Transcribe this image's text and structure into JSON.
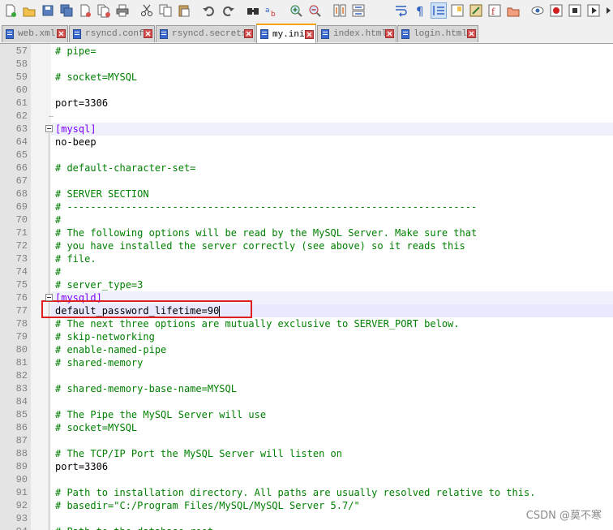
{
  "toolbar": {
    "icons": [
      {
        "name": "new-file-icon"
      },
      {
        "name": "open-file-icon"
      },
      {
        "name": "save-icon"
      },
      {
        "name": "save-all-icon"
      },
      {
        "name": "close-icon"
      },
      {
        "name": "close-all-icon"
      },
      {
        "name": "print-icon"
      },
      {
        "name": "cut-icon"
      },
      {
        "name": "copy-icon"
      },
      {
        "name": "paste-icon"
      },
      {
        "name": "undo-icon"
      },
      {
        "name": "redo-icon"
      },
      {
        "name": "find-icon"
      },
      {
        "name": "replace-icon"
      },
      {
        "name": "zoom-in-icon"
      },
      {
        "name": "zoom-out-icon"
      },
      {
        "name": "sync-vertical-icon"
      },
      {
        "name": "sync-horizontal-icon"
      },
      {
        "name": "word-wrap-icon"
      },
      {
        "name": "show-all-characters-icon"
      },
      {
        "name": "indent-guide-icon"
      },
      {
        "name": "document-map-icon"
      },
      {
        "name": "function-list-icon"
      },
      {
        "name": "folder-workspace-icon"
      },
      {
        "name": "monitoring-icon"
      },
      {
        "name": "record-macro-icon"
      },
      {
        "name": "stop-recording-icon"
      },
      {
        "name": "playback-macro-icon"
      },
      {
        "name": "run-macro-multiple-icon"
      }
    ]
  },
  "tabs": [
    {
      "label": "web.xml",
      "active": false
    },
    {
      "label": "rsyncd.conf",
      "active": false
    },
    {
      "label": "rsyncd.secrets",
      "active": false
    },
    {
      "label": "my.ini",
      "active": true
    },
    {
      "label": "index.html",
      "active": false
    },
    {
      "label": "login.html",
      "active": false
    }
  ],
  "editor": {
    "lines": [
      {
        "n": "57",
        "text": "# pipe=",
        "kind": "comment"
      },
      {
        "n": "58",
        "text": "",
        "kind": "blank"
      },
      {
        "n": "59",
        "text": "# socket=MYSQL",
        "kind": "comment"
      },
      {
        "n": "60",
        "text": "",
        "kind": "blank"
      },
      {
        "n": "61",
        "key": "port",
        "value": "3306",
        "kind": "kv"
      },
      {
        "n": "62",
        "text": "",
        "kind": "blank"
      },
      {
        "n": "63",
        "text": "[mysql]",
        "kind": "section"
      },
      {
        "n": "64",
        "text": "no-beep",
        "kind": "plain"
      },
      {
        "n": "65",
        "text": "",
        "kind": "blank"
      },
      {
        "n": "66",
        "text": "# default-character-set=",
        "kind": "comment"
      },
      {
        "n": "67",
        "text": "",
        "kind": "blank"
      },
      {
        "n": "68",
        "text": "# SERVER SECTION",
        "kind": "comment"
      },
      {
        "n": "69",
        "text": "# ----------------------------------------------------------------------",
        "kind": "comment"
      },
      {
        "n": "70",
        "text": "#",
        "kind": "comment"
      },
      {
        "n": "71",
        "text": "# The following options will be read by the MySQL Server. Make sure that",
        "kind": "comment"
      },
      {
        "n": "72",
        "text": "# you have installed the server correctly (see above) so it reads this",
        "kind": "comment"
      },
      {
        "n": "73",
        "text": "# file.",
        "kind": "comment"
      },
      {
        "n": "74",
        "text": "#",
        "kind": "comment"
      },
      {
        "n": "75",
        "text": "# server_type=3",
        "kind": "comment"
      },
      {
        "n": "76",
        "text": "[mysqld]",
        "kind": "section"
      },
      {
        "n": "77",
        "key": "default_password_lifetime",
        "value": "90",
        "kind": "kv"
      },
      {
        "n": "78",
        "text": "# The next three options are mutually exclusive to SERVER_PORT below.",
        "kind": "comment"
      },
      {
        "n": "79",
        "text": "# skip-networking",
        "kind": "comment"
      },
      {
        "n": "80",
        "text": "# enable-named-pipe",
        "kind": "comment"
      },
      {
        "n": "81",
        "text": "# shared-memory",
        "kind": "comment"
      },
      {
        "n": "82",
        "text": "",
        "kind": "blank"
      },
      {
        "n": "83",
        "text": "# shared-memory-base-name=MYSQL",
        "kind": "comment"
      },
      {
        "n": "84",
        "text": "",
        "kind": "blank"
      },
      {
        "n": "85",
        "text": "# The Pipe the MySQL Server will use",
        "kind": "comment"
      },
      {
        "n": "86",
        "text": "# socket=MYSQL",
        "kind": "comment"
      },
      {
        "n": "87",
        "text": "",
        "kind": "blank"
      },
      {
        "n": "88",
        "text": "# The TCP/IP Port the MySQL Server will listen on",
        "kind": "comment"
      },
      {
        "n": "89",
        "key": "port",
        "value": "3306",
        "kind": "kv"
      },
      {
        "n": "90",
        "text": "",
        "kind": "blank"
      },
      {
        "n": "91",
        "text": "# Path to installation directory. All paths are usually resolved relative to this.",
        "kind": "comment"
      },
      {
        "n": "92",
        "text": "# basedir=\"C:/Program Files/MySQL/MySQL Server 5.7/\"",
        "kind": "comment"
      },
      {
        "n": "93",
        "text": "",
        "kind": "blank"
      },
      {
        "n": "94",
        "text": "# Path to the database root",
        "kind": "comment"
      }
    ]
  },
  "watermark": "CSDN @莫不寒",
  "colors": {
    "comment": "#008000",
    "section": "#8000ff",
    "annotation_box": "#e02020",
    "active_tab_accent": "#f8a100"
  }
}
